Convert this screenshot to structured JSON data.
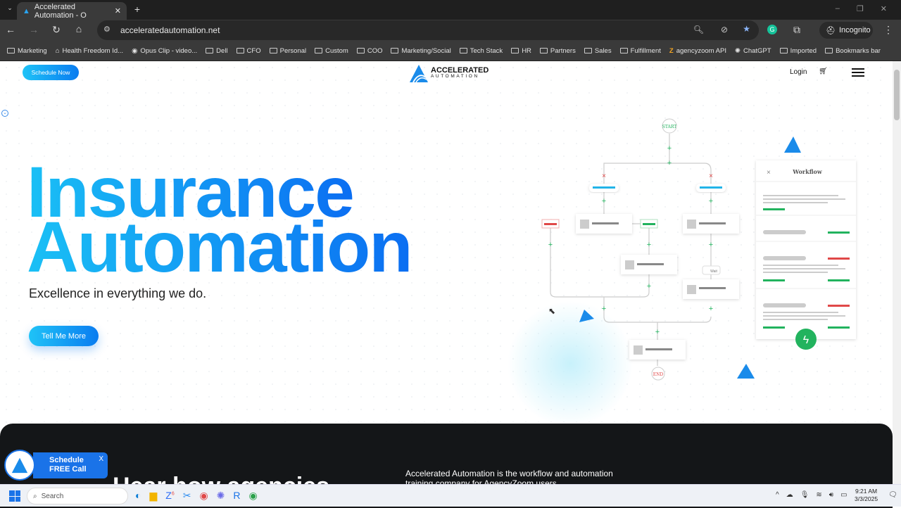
{
  "browser": {
    "tab_title": "Accelerated Automation - O",
    "url": "acceleratedautomation.net",
    "profile": "Incognito",
    "bookmarks": [
      "Marketing",
      "Health Freedom Id...",
      "Opus Clip - video...",
      "Dell",
      "CFO",
      "Personal",
      "Custom",
      "COO",
      "Marketing/Social",
      "Tech Stack",
      "HR",
      "Partners",
      "Sales",
      "Fulfillment",
      "agencyzoom API",
      "ChatGPT",
      "Imported",
      "Bookmarks bar"
    ]
  },
  "header": {
    "schedule_label": "Schedule Now",
    "logo_line1": "ACCELERATED",
    "logo_line2": "AUTOMATION",
    "login_label": "Login"
  },
  "hero": {
    "title_line1": "Insurance",
    "title_line2": "Automation",
    "subtitle": "Excellence in everything we do.",
    "cta_label": "Tell Me More"
  },
  "diagram": {
    "start_label": "START",
    "end_label": "END",
    "wait_label": "Wait",
    "panel_title": "Workflow"
  },
  "dark_section": {
    "heading": "Hear how agencies",
    "description_line1": "Accelerated Automation is the workflow and automation",
    "description_line2": "training company for AgencyZoom users."
  },
  "widget": {
    "line1": "Schedule",
    "line2": "FREE Call",
    "close": "X"
  },
  "taskbar": {
    "search_placeholder": "Search",
    "time": "9:21 AM",
    "date": "3/3/2025",
    "zoom_badge": "6"
  },
  "colors": {
    "accent_start": "#1ac0f5",
    "accent_end": "#0b6ef2",
    "green": "#22b35e",
    "red": "#e04848"
  }
}
